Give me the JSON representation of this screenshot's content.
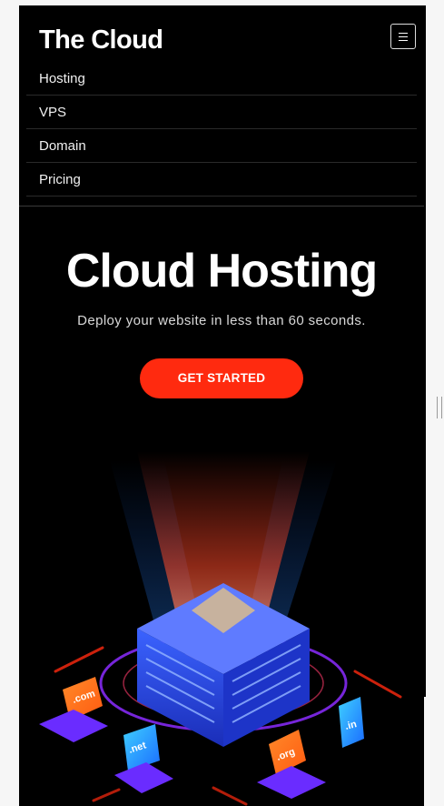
{
  "header": {
    "brand": "The Cloud",
    "menu_icon": "hamburger-menu-icon"
  },
  "nav": {
    "items": [
      {
        "label": "Hosting"
      },
      {
        "label": "VPS"
      },
      {
        "label": "Domain"
      },
      {
        "label": "Pricing"
      }
    ]
  },
  "hero": {
    "title": "Cloud Hosting",
    "subtitle": "Deploy your website in less than 60 seconds.",
    "cta_label": "GET STARTED"
  },
  "illustration": {
    "tlds": [
      ".com",
      ".net",
      ".org",
      ".in"
    ]
  },
  "colors": {
    "background": "#000000",
    "accent": "#ff2a0f",
    "text": "#ffffff"
  }
}
